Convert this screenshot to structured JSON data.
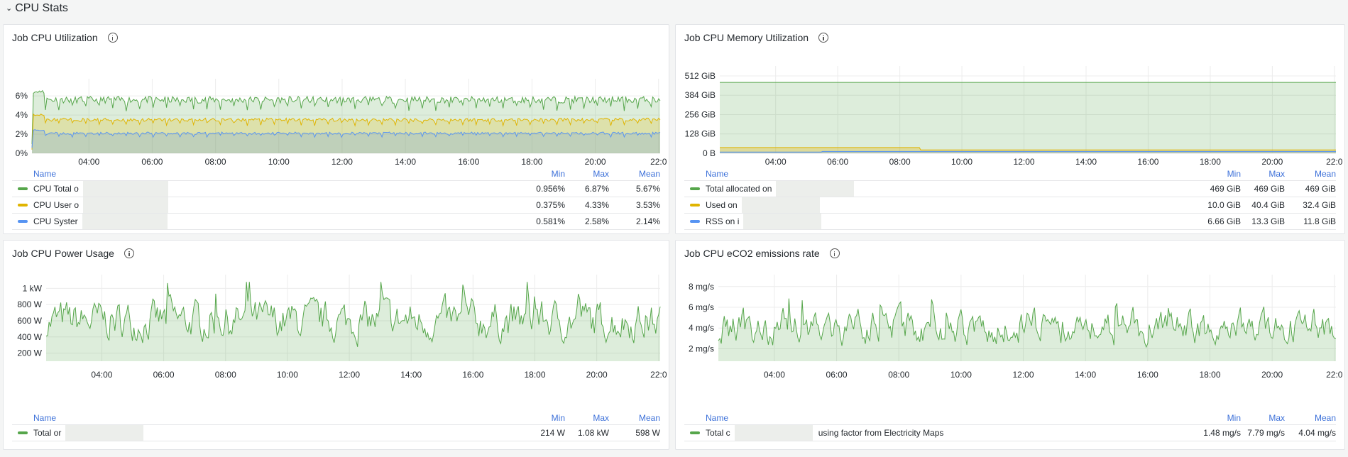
{
  "row": {
    "title": "CPU Stats",
    "collapsed": false
  },
  "panels": [
    {
      "id": "cpu-util",
      "title": "Job CPU Utilization",
      "y_ticks": [
        "0%",
        "2%",
        "4%",
        "6%"
      ],
      "x_ticks": [
        "04:00",
        "06:00",
        "08:00",
        "10:00",
        "12:00",
        "14:00",
        "16:00",
        "18:00",
        "20:00",
        "22:0"
      ],
      "legend_headers": {
        "name": "Name",
        "min": "Min",
        "max": "Max",
        "mean": "Mean"
      },
      "series": [
        {
          "name": "CPU Total o",
          "color": "#56a64b",
          "min": "0.956%",
          "max": "6.87%",
          "mean": "5.67%"
        },
        {
          "name": "CPU User o",
          "color": "#e0b400",
          "min": "0.375%",
          "max": "4.33%",
          "mean": "3.53%"
        },
        {
          "name": "CPU Syster",
          "color": "#5794f2",
          "min": "0.581%",
          "max": "2.58%",
          "mean": "2.14%"
        }
      ]
    },
    {
      "id": "cpu-mem",
      "title": "Job CPU Memory Utilization",
      "y_ticks": [
        "0 B",
        "128 GiB",
        "256 GiB",
        "384 GiB",
        "512 GiB"
      ],
      "x_ticks": [
        "04:00",
        "06:00",
        "08:00",
        "10:00",
        "12:00",
        "14:00",
        "16:00",
        "18:00",
        "20:00",
        "22:0"
      ],
      "legend_headers": {
        "name": "Name",
        "min": "Min",
        "max": "Max",
        "mean": "Mean"
      },
      "series": [
        {
          "name": "Total allocated on",
          "color": "#56a64b",
          "min": "469 GiB",
          "max": "469 GiB",
          "mean": "469 GiB"
        },
        {
          "name": "Used on",
          "color": "#e0b400",
          "min": "10.0 GiB",
          "max": "40.4 GiB",
          "mean": "32.4 GiB"
        },
        {
          "name": "RSS on i",
          "color": "#5794f2",
          "min": "6.66 GiB",
          "max": "13.3 GiB",
          "mean": "11.8 GiB"
        }
      ]
    },
    {
      "id": "cpu-power",
      "title": "Job CPU Power Usage",
      "y_ticks": [
        "200 W",
        "400 W",
        "600 W",
        "800 W",
        "1 kW"
      ],
      "x_ticks": [
        "04:00",
        "06:00",
        "08:00",
        "10:00",
        "12:00",
        "14:00",
        "16:00",
        "18:00",
        "20:00",
        "22:0"
      ],
      "legend_headers": {
        "name": "Name",
        "min": "Min",
        "max": "Max",
        "mean": "Mean"
      },
      "series": [
        {
          "name": "Total or",
          "color": "#56a64b",
          "min": "214 W",
          "max": "1.08 kW",
          "mean": "598 W"
        }
      ]
    },
    {
      "id": "cpu-eco2",
      "title": "Job CPU eCO2 emissions rate",
      "y_ticks": [
        "2 mg/s",
        "4 mg/s",
        "6 mg/s",
        "8 mg/s"
      ],
      "x_ticks": [
        "04:00",
        "06:00",
        "08:00",
        "10:00",
        "12:00",
        "14:00",
        "16:00",
        "18:00",
        "20:00",
        "22:0"
      ],
      "legend_headers": {
        "name": "Name",
        "min": "Min",
        "max": "Max",
        "mean": "Mean"
      },
      "series": [
        {
          "name": "Total c",
          "name_suffix": "using factor from Electricity Maps",
          "color": "#56a64b",
          "min": "1.48 mg/s",
          "max": "7.79 mg/s",
          "mean": "4.04 mg/s"
        }
      ]
    }
  ],
  "chart_data": [
    {
      "type": "area",
      "title": "Job CPU Utilization",
      "xlabel": "",
      "ylabel": "",
      "x_range": [
        "02:15",
        "22:00"
      ],
      "ylim": [
        0,
        7.2
      ],
      "y_unit": "%",
      "series": [
        {
          "name": "CPU Total",
          "stats": {
            "min": 0.956,
            "max": 6.87,
            "mean": 5.67
          },
          "approx_level": 5.7
        },
        {
          "name": "CPU User",
          "stats": {
            "min": 0.375,
            "max": 4.33,
            "mean": 3.53
          },
          "approx_level": 3.5
        },
        {
          "name": "CPU System",
          "stats": {
            "min": 0.581,
            "max": 2.58,
            "mean": 2.14
          },
          "approx_level": 2.1
        }
      ],
      "legend": "bottom"
    },
    {
      "type": "area",
      "title": "Job CPU Memory Utilization",
      "x_range": [
        "02:15",
        "22:00"
      ],
      "ylim": [
        0,
        540
      ],
      "y_unit": "GiB",
      "series": [
        {
          "name": "Total allocated",
          "stats": {
            "min": 469,
            "max": 469,
            "mean": 469
          },
          "approx_level": 469
        },
        {
          "name": "Used",
          "stats": {
            "min": 10.0,
            "max": 40.4,
            "mean": 32.4
          },
          "step": {
            "before": 40,
            "after": 24,
            "change_at": "08:40"
          }
        },
        {
          "name": "RSS",
          "stats": {
            "min": 6.66,
            "max": 13.3,
            "mean": 11.8
          },
          "approx_level": 12
        }
      ],
      "legend": "bottom"
    },
    {
      "type": "area",
      "title": "Job CPU Power Usage",
      "x_range": [
        "02:15",
        "22:00"
      ],
      "ylim": [
        100,
        1100
      ],
      "y_unit": "W",
      "series": [
        {
          "name": "Total",
          "stats": {
            "min": 214,
            "max": 1080,
            "mean": 598
          }
        }
      ],
      "legend": "bottom"
    },
    {
      "type": "area",
      "title": "Job CPU eCO2 emissions rate",
      "x_range": [
        "02:15",
        "22:00"
      ],
      "ylim": [
        0.8,
        8.6
      ],
      "y_unit": "mg/s",
      "series": [
        {
          "name": "Total using factor from Electricity Maps",
          "stats": {
            "min": 1.48,
            "max": 7.79,
            "mean": 4.04
          }
        }
      ],
      "legend": "bottom"
    }
  ]
}
